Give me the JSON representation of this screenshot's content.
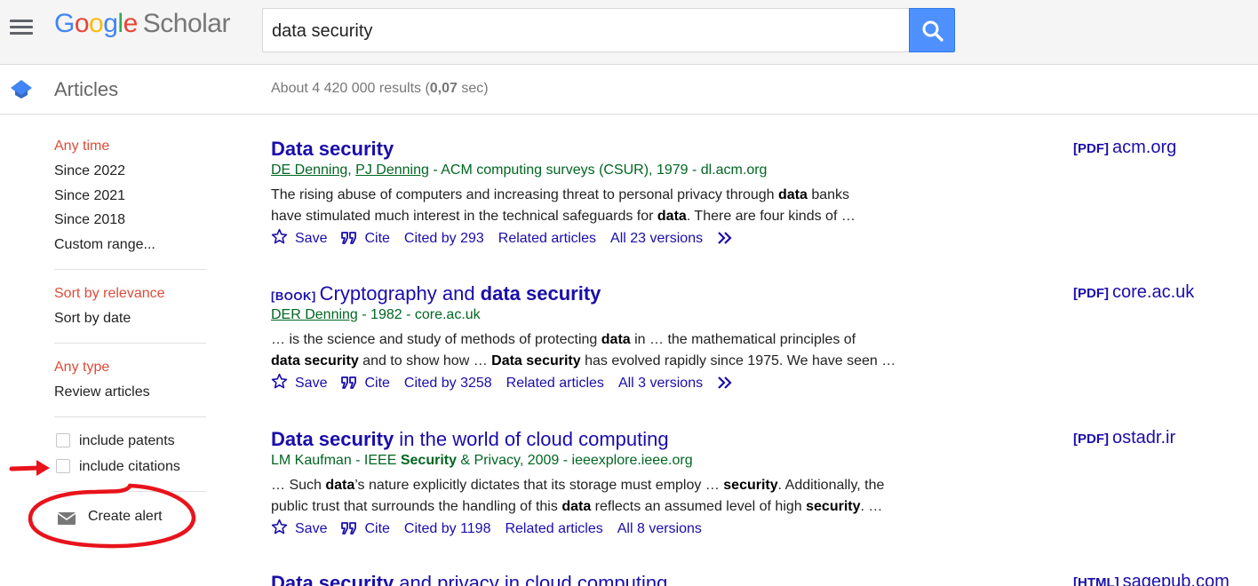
{
  "header": {
    "logo": {
      "google": "Google",
      "scholar": "Scholar"
    },
    "search": {
      "value": "data security",
      "placeholder": ""
    },
    "search_icon": "search-icon"
  },
  "subheader": {
    "section_label": "Articles",
    "results": {
      "prefix": "About 4 420 000 results (",
      "time": "0,07",
      "suffix": " sec)"
    }
  },
  "sidebar": {
    "time_filters": [
      "Any time",
      "Since 2022",
      "Since 2021",
      "Since 2018",
      "Custom range..."
    ],
    "sort_options": [
      "Sort by relevance",
      "Sort by date"
    ],
    "type_filters": [
      "Any type",
      "Review articles"
    ],
    "checkboxes": [
      "include patents",
      "include citations"
    ],
    "create_alert": "Create alert",
    "active": [
      "Any time",
      "Sort by relevance",
      "Any type"
    ]
  },
  "results": [
    {
      "kind": "",
      "title_parts": [
        {
          "t": "Data security",
          "b": true
        }
      ],
      "authors": [
        "DE Denning",
        "PJ Denning"
      ],
      "meta_rest": " - ACM computing surveys (CSUR), 1979 - dl.acm.org",
      "snippet_lines": [
        [
          {
            "t": "The rising abuse of computers and increasing threat to personal privacy through ",
            "b": false
          },
          {
            "t": "data",
            "b": true
          },
          {
            "t": " banks",
            "b": false
          }
        ],
        [
          {
            "t": "have stimulated much interest in the technical safeguards for ",
            "b": false
          },
          {
            "t": "data",
            "b": true
          },
          {
            "t": ". There are four kinds of …",
            "b": false
          }
        ]
      ],
      "actions": {
        "save": "Save",
        "cite": "Cite",
        "cited_by": "Cited by 293",
        "related": "Related articles",
        "versions": "All 23 versions",
        "more": true
      },
      "side": {
        "type": "[PDF]",
        "domain": "acm.org"
      }
    },
    {
      "kind": "[BOOK]",
      "title_parts": [
        {
          "t": "Cryptography and ",
          "b": false
        },
        {
          "t": "data security",
          "b": true
        }
      ],
      "authors": [
        "DER Denning"
      ],
      "meta_rest": " - 1982 - core.ac.uk",
      "snippet_lines": [
        [
          {
            "t": "… is the science and study of methods of protecting ",
            "b": false
          },
          {
            "t": "data",
            "b": true
          },
          {
            "t": " in … the mathematical principles of",
            "b": false
          }
        ],
        [
          {
            "t": "data security",
            "b": true
          },
          {
            "t": " and to show how … ",
            "b": false
          },
          {
            "t": "Data security",
            "b": true
          },
          {
            "t": " has evolved rapidly since 1975. We have seen …",
            "b": false
          }
        ]
      ],
      "actions": {
        "save": "Save",
        "cite": "Cite",
        "cited_by": "Cited by 3258",
        "related": "Related articles",
        "versions": "All 3 versions",
        "more": true
      },
      "side": {
        "type": "[PDF]",
        "domain": "core.ac.uk"
      }
    },
    {
      "kind": "",
      "title_parts": [
        {
          "t": "Data security",
          "b": true
        },
        {
          "t": " in the world of cloud computing",
          "b": false
        }
      ],
      "authors": [],
      "meta_parts": [
        {
          "t": "LM Kaufman - IEEE ",
          "b": false
        },
        {
          "t": "Security",
          "b": true
        },
        {
          "t": " & Privacy, 2009 - ieeexplore.ieee.org",
          "b": false
        }
      ],
      "snippet_lines": [
        [
          {
            "t": "… Such ",
            "b": false
          },
          {
            "t": "data",
            "b": true
          },
          {
            "t": "’s nature explicitly dictates that its storage must employ … ",
            "b": false
          },
          {
            "t": "security",
            "b": true
          },
          {
            "t": ". Additionally, the",
            "b": false
          }
        ],
        [
          {
            "t": "public trust that surrounds the handling of this ",
            "b": false
          },
          {
            "t": "data",
            "b": true
          },
          {
            "t": " reflects an assumed level of high ",
            "b": false
          },
          {
            "t": "security",
            "b": true
          },
          {
            "t": ". …",
            "b": false
          }
        ]
      ],
      "actions": {
        "save": "Save",
        "cite": "Cite",
        "cited_by": "Cited by 1198",
        "related": "Related articles",
        "versions": "All 8 versions",
        "more": false
      },
      "side": {
        "type": "[PDF]",
        "domain": "ostadr.ir"
      }
    },
    {
      "kind": "",
      "title_parts": [
        {
          "t": "Data security",
          "b": true
        },
        {
          "t": " and privacy in cloud computing",
          "b": false
        }
      ],
      "authors": [],
      "meta_rest": "",
      "snippet_lines": [],
      "actions": null,
      "side": {
        "type": "[HTML]",
        "domain": "sagepub.com"
      }
    }
  ],
  "colors": {
    "link": "#1a0dab",
    "meta_green": "#006621",
    "active_filter": "#dd4b39",
    "search_button": "#4d90fe",
    "annotation": "#e8131b"
  }
}
